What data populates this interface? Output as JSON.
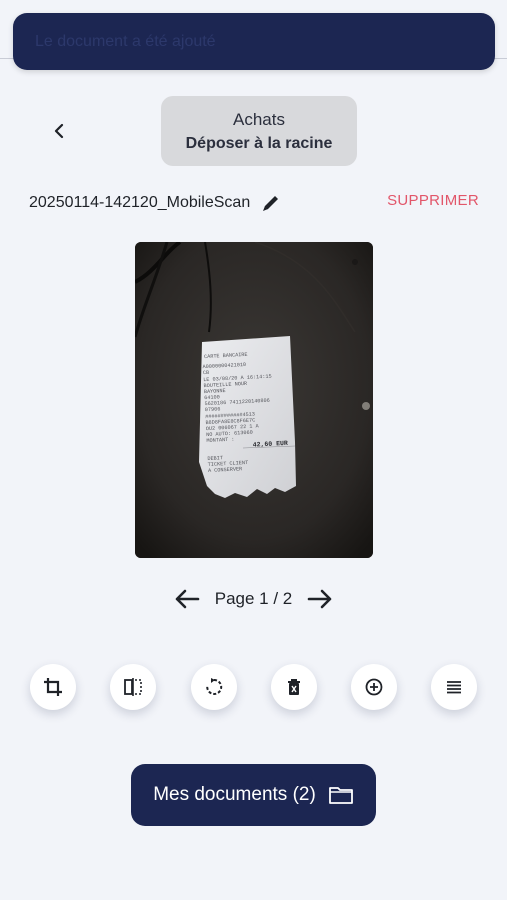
{
  "toast": {
    "message": "Le document a été ajouté"
  },
  "header": {
    "folder_name": "Achats",
    "folder_action": "Déposer à la racine"
  },
  "file": {
    "name": "20250114-142120_MobileScan",
    "delete_label": "SUPPRIMER"
  },
  "receipt": {
    "header": "CARTE BANCAIRE",
    "line_1": "A0000000421010",
    "line_2": "CB",
    "line_3": "LE 03/08/20 A 16:14:15",
    "line_4": "BOUTEILLE NOUR",
    "line_5": "BAYONNE",
    "line_6": "64100",
    "line_7": "5620186 7411220140806",
    "line_8": "07906",
    "line_9": "############4513",
    "line_10": "B8D8FA8E8C8F6E7C",
    "line_11": "OU2 006067 22 1 A",
    "line_12": "NO AUTO: 613060",
    "line_13": "MONTANT :",
    "amount": "42,60 EUR",
    "line_14": "DEBIT",
    "line_15": "TICKET CLIENT",
    "line_16": "A CONSERVER"
  },
  "pager": {
    "label": "Page 1 / 2"
  },
  "toolbar": {
    "icons": [
      "crop-icon",
      "split-icon",
      "rotate-icon",
      "delete-page-icon",
      "add-page-icon",
      "reorder-icon"
    ]
  },
  "footer": {
    "documents_label": "Mes documents (2)"
  },
  "colors": {
    "primary": "#1c2652",
    "danger": "#e2566a",
    "background": "#f2f4f9"
  }
}
